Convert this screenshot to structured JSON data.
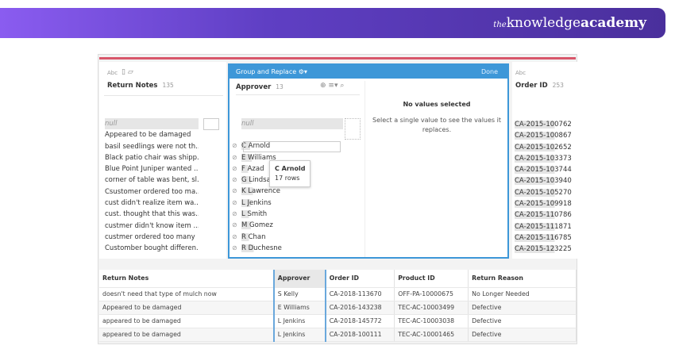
{
  "brand": {
    "logo_prefix": "the",
    "logo_main": "knowledge",
    "logo_bold": "academy"
  },
  "return_notes": {
    "type": "Abc",
    "title": "Return Notes",
    "count": "135",
    "items": [
      "null",
      "Appeared to be damaged",
      "basil seedlings were not th...",
      "Black patio chair was shipp...",
      "Blue Point Juniper wanted ...",
      "corner of table was bent, sl...",
      "Csustomer ordered too ma...",
      "cust didn't realize item wa...",
      "cust. thought that this was...",
      "custmer didn't know item ...",
      "custmer ordered too many",
      "Customber bought differen..."
    ]
  },
  "group_replace": {
    "title": "Group and Replace",
    "done": "Done",
    "field": "Approver",
    "count": "13",
    "items": [
      "null",
      "C Arnold",
      "E Williams",
      "F Azad",
      "G Lindsay",
      "K Lawrence",
      "L Jenkins",
      "L Smith",
      "M Gomez",
      "R Chan",
      "R Duchesne"
    ],
    "tooltip": {
      "name": "C Arnold",
      "rows": "17 rows"
    },
    "empty_title": "No values selected",
    "empty_text": "Select a single value to see the values it replaces."
  },
  "order_id": {
    "type": "Abc",
    "title": "Order ID",
    "count": "253",
    "items": [
      "CA-2015-100762",
      "CA-2015-100867",
      "CA-2015-102652",
      "CA-2015-103373",
      "CA-2015-103744",
      "CA-2015-103940",
      "CA-2015-105270",
      "CA-2015-109918",
      "CA-2015-110786",
      "CA-2015-111871",
      "CA-2015-116785",
      "CA-2015-123225"
    ]
  },
  "table": {
    "columns": [
      "Return Notes",
      "Approver",
      "Order ID",
      "Product ID",
      "Return Reason"
    ],
    "rows": [
      [
        "doesn't need that type of mulch now",
        "S Kelly",
        "CA-2018-113670",
        "OFF-PA-10000675",
        "No Longer Needed"
      ],
      [
        "Appeared to be damaged",
        "E Williams",
        "CA-2016-143238",
        "TEC-AC-10003499",
        "Defective"
      ],
      [
        "appeared to be damaged",
        "L Jenkins",
        "CA-2018-145772",
        "TEC-AC-10003038",
        "Defective"
      ],
      [
        "appeared to be damaged",
        "L Jenkins",
        "CA-2018-100111",
        "TEC-AC-10001465",
        "Defective"
      ]
    ]
  },
  "colors": {
    "accent": "#3d97d8",
    "pink": "#d8566a",
    "banner": "#5f3fc4"
  }
}
